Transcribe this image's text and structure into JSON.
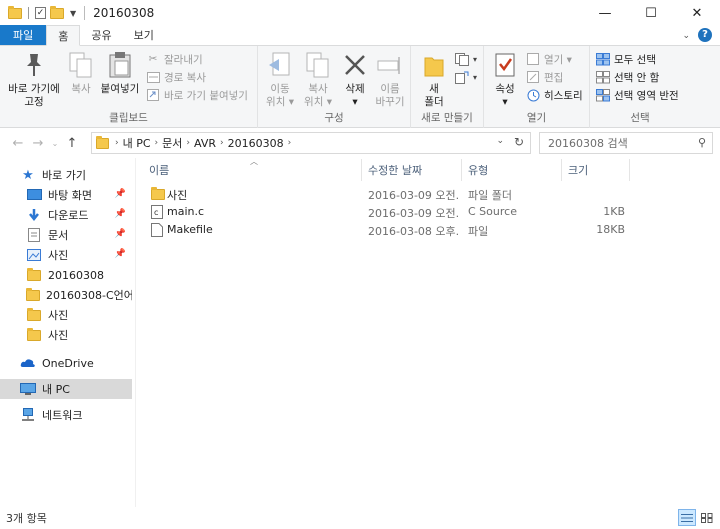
{
  "window": {
    "title": "20160308",
    "controls": {
      "minimize": "—",
      "maximize": "☐",
      "close": "✕"
    }
  },
  "ribbon_tabs": [
    {
      "label": "파일"
    },
    {
      "label": "홈"
    },
    {
      "label": "공유"
    },
    {
      "label": "보기"
    }
  ],
  "ribbon": {
    "clipboard": {
      "label": "클립보드",
      "pin": "바로 가기에\n고정",
      "copy": "복사",
      "paste": "붙여넣기",
      "cut": "잘라내기",
      "copy_path": "경로 복사",
      "paste_shortcut": "바로 가기 붙여넣기"
    },
    "organize": {
      "label": "구성",
      "move_to": "이동\n위치 ▾",
      "copy_to": "복사\n위치 ▾",
      "delete": "삭제\n▾",
      "rename": "이름\n바꾸기"
    },
    "new": {
      "label": "새로 만들기",
      "new_folder": "새\n폴더"
    },
    "open": {
      "label": "열기",
      "properties": "속성\n▾",
      "open": "열기 ▾",
      "edit": "편집",
      "history": "히스토리"
    },
    "select": {
      "label": "선택",
      "select_all": "모두 선택",
      "select_none": "선택 안 함",
      "invert": "선택 영역 반전"
    }
  },
  "address": {
    "crumbs": [
      "내 PC",
      "문서",
      "AVR",
      "20160308"
    ],
    "search_placeholder": "20160308 검색"
  },
  "nav_pane": {
    "quick_access": "바로 가기",
    "items": [
      {
        "label": "바탕 화면",
        "pinned": true
      },
      {
        "label": "다운로드",
        "pinned": true
      },
      {
        "label": "문서",
        "pinned": true
      },
      {
        "label": "사진",
        "pinned": true
      },
      {
        "label": "20160308"
      },
      {
        "label": "20160308-C언어마"
      },
      {
        "label": "사진"
      },
      {
        "label": "사진"
      }
    ],
    "onedrive": "OneDrive",
    "this_pc": "내 PC",
    "network": "네트워크"
  },
  "columns": [
    "이름",
    "수정한 날짜",
    "유형",
    "크기"
  ],
  "files": [
    {
      "name": "사진",
      "modified": "2016-03-09 오전...",
      "type": "파일 폴더",
      "size": "",
      "icon": "folder-icon"
    },
    {
      "name": "main.c",
      "modified": "2016-03-09 오전...",
      "type": "C Source",
      "size": "1KB",
      "icon": "c-source-file-icon"
    },
    {
      "name": "Makefile",
      "modified": "2016-03-08 오후...",
      "type": "파일",
      "size": "18KB",
      "icon": "file-icon"
    }
  ],
  "status": {
    "item_count": "3개 항목"
  },
  "colors": {
    "accent": "#1979ca",
    "folder": "#f5c84c",
    "selected": "#d9d9d9"
  }
}
